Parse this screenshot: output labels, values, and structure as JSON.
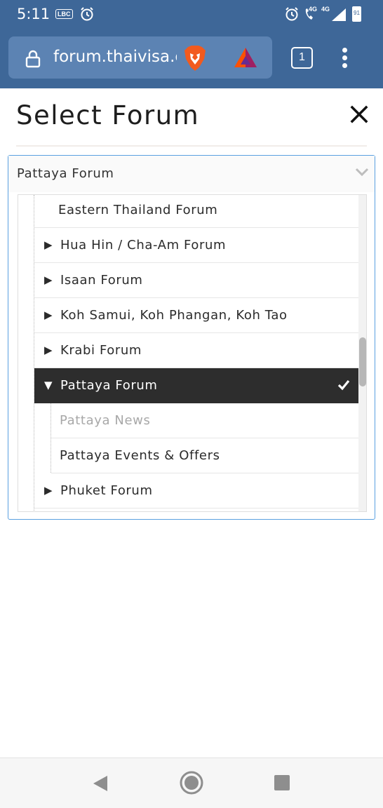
{
  "status_bar": {
    "time": "5:11",
    "carrier_badge": "LBC",
    "network_left": "4G",
    "network_right": "4G",
    "battery": "91"
  },
  "browser": {
    "url": "forum.thaivisa.com",
    "tab_count": "1",
    "icons": [
      "lock-icon",
      "brave-lion-icon",
      "bat-rewards-icon",
      "tabs-icon",
      "overflow-menu-icon"
    ]
  },
  "dialog": {
    "title": "Select Forum",
    "close_icon": "close-icon",
    "select": {
      "selected_value": "Pattaya Forum",
      "chevron_icon": "chevron-down-icon",
      "options": [
        {
          "label": "Eastern Thailand Forum",
          "expandable": false,
          "expanded": false,
          "selected": false,
          "muted": false,
          "level": 1
        },
        {
          "label": "Hua Hin / Cha-Am Forum",
          "expandable": true,
          "expanded": false,
          "selected": false,
          "muted": false,
          "level": 1
        },
        {
          "label": "Isaan Forum",
          "expandable": true,
          "expanded": false,
          "selected": false,
          "muted": false,
          "level": 1
        },
        {
          "label": "Koh Samui, Koh Phangan, Koh Tao",
          "expandable": true,
          "expanded": false,
          "selected": false,
          "muted": false,
          "level": 1
        },
        {
          "label": "Krabi Forum",
          "expandable": true,
          "expanded": false,
          "selected": false,
          "muted": false,
          "level": 1
        },
        {
          "label": "Pattaya Forum",
          "expandable": true,
          "expanded": true,
          "selected": true,
          "muted": false,
          "level": 1
        },
        {
          "label": "Pattaya News",
          "expandable": false,
          "expanded": false,
          "selected": false,
          "muted": true,
          "level": 2
        },
        {
          "label": "Pattaya Events & Offers",
          "expandable": false,
          "expanded": false,
          "selected": false,
          "muted": false,
          "level": 2
        },
        {
          "label": "Phuket Forum",
          "expandable": true,
          "expanded": false,
          "selected": false,
          "muted": false,
          "level": 1
        }
      ]
    }
  },
  "colors": {
    "toolbar": "#3e6798",
    "url_field": "#5c83b3",
    "select_border": "#5aa0e0",
    "selected_row": "#2d2d2d"
  },
  "nav_bar": {
    "icons": [
      "back-icon",
      "home-icon",
      "recents-icon"
    ]
  }
}
